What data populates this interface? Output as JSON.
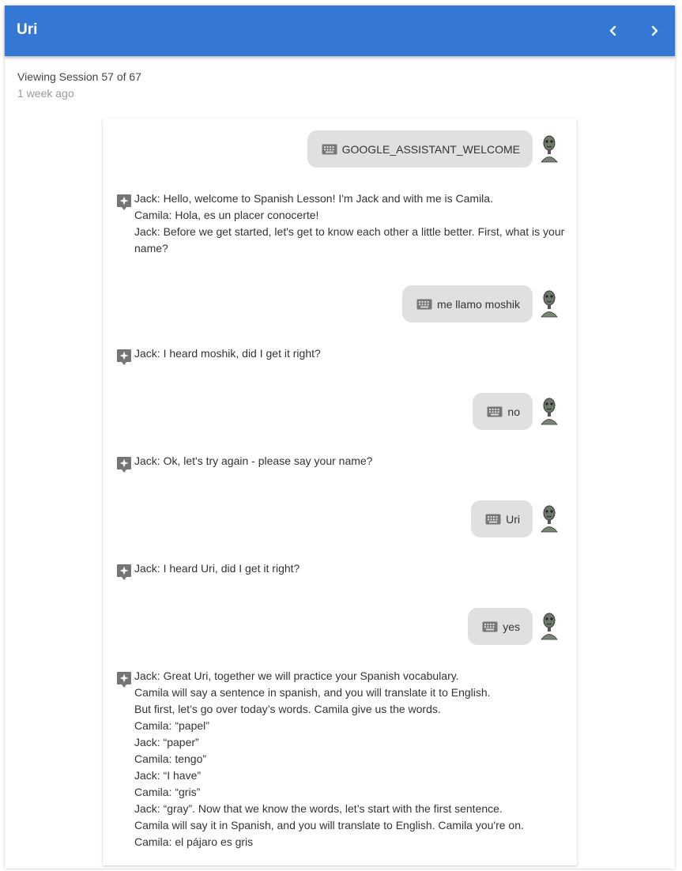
{
  "header": {
    "title": "Uri",
    "prev_icon": "chevron-left-icon",
    "next_icon": "chevron-right-icon"
  },
  "session": {
    "viewing": "Viewing Session 57 of 67",
    "time_ago": "1 week ago"
  },
  "colors": {
    "header_bg": "#3477d5",
    "user_bubble": "#e0e0e0",
    "icon_gray": "#777777"
  },
  "messages": [
    {
      "type": "user",
      "icon": "keyboard-icon",
      "text": "GOOGLE_ASSISTANT_WELCOME"
    },
    {
      "type": "bot",
      "icon": "assistant-icon",
      "lines": [
        "Jack: Hello, welcome to Spanish Lesson! I'm Jack and with me is Camila.",
        "Camila: Hola, es un placer conocerte!",
        "Jack: Before we get started, let's get to know each other a little better. First, what is your",
        "name?"
      ]
    },
    {
      "type": "user",
      "icon": "keyboard-icon",
      "text": "me llamo moshik"
    },
    {
      "type": "bot",
      "icon": "assistant-icon",
      "lines": [
        "Jack: I heard moshik, did I get it right?"
      ]
    },
    {
      "type": "user",
      "icon": "keyboard-icon",
      "text": "no"
    },
    {
      "type": "bot",
      "icon": "assistant-icon",
      "lines": [
        "Jack: Ok, let's try again - please say your name?"
      ]
    },
    {
      "type": "user",
      "icon": "keyboard-icon",
      "text": "Uri"
    },
    {
      "type": "bot",
      "icon": "assistant-icon",
      "lines": [
        "Jack: I heard Uri, did I get it right?"
      ]
    },
    {
      "type": "user",
      "icon": "keyboard-icon",
      "text": "yes"
    },
    {
      "type": "bot",
      "icon": "assistant-icon",
      "lines": [
        "Jack: Great Uri, together we will practice your Spanish vocabulary.",
        "Camila will say a sentence in spanish, and you will translate it to English.",
        "But first, let’s go over today’s words. Camila give us the words.",
        "Camila: “papel”",
        "Jack: “paper”",
        "Camila: tengo”",
        "Jack: “I have”",
        "Camila: “gris”",
        "Jack: “gray”. Now that we know the words, let’s start with the first sentence.",
        "Camila will say it in Spanish, and you will translate to English. Camila you're on.",
        "Camila: el pájaro es gris"
      ]
    }
  ]
}
